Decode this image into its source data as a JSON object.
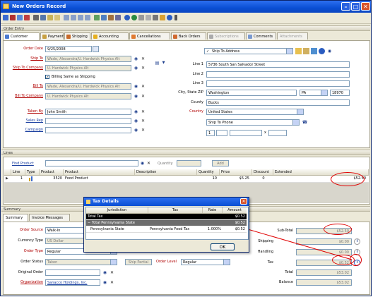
{
  "window": {
    "title": "New Orders Record"
  },
  "sections": {
    "order_entry": "Order Entry",
    "lines": "Lines",
    "summary": "Summary"
  },
  "tabs": [
    {
      "label": "Customer",
      "active": true
    },
    {
      "label": "Payment"
    },
    {
      "label": "Shipping"
    },
    {
      "label": "Accounting"
    },
    {
      "label": "Cancellations"
    },
    {
      "label": "Back Orders"
    },
    {
      "label": "Subscriptions",
      "disabled": true
    },
    {
      "label": "Comments"
    },
    {
      "label": "Attachments",
      "disabled": true
    }
  ],
  "customer": {
    "order_date_label": "Order Date",
    "order_date": "9/25/2008",
    "ship_to_label": "Ship To",
    "ship_to": "Wade, Alexandra/U. Hardwick Physics Alt",
    "ship_to_company_label": "Ship To Company",
    "ship_to_company": "U. Hardwick Physics Alt",
    "billing_same_label": "Billing Same as Shipping",
    "bill_to_label": "Bill To",
    "bill_to": "Wade, Alexandra/U. Hardwick Physics Alt",
    "bill_to_company_label": "Bill To Company",
    "bill_to_company": "U. Hardwick Physics Alt",
    "taken_by_label": "Taken By",
    "taken_by": "John Smith",
    "sales_rep_label": "Sales Rep",
    "sales_rep": "",
    "campaign_label": "Campaign",
    "campaign": ""
  },
  "address": {
    "type": "Ship To Address",
    "line1_label": "Line 1",
    "line1": "5736 South San Salvador Street",
    "line2_label": "Line 2",
    "line2": "",
    "line3_label": "Line 3",
    "line3": "",
    "city_label": "City, State ZIP",
    "city": "Washington",
    "state": "PA",
    "zip": "18970",
    "county_label": "County",
    "county": "Bucks",
    "country_label": "Country",
    "country": "United States",
    "phone_type": "Ship To Phone",
    "phone1": "1",
    "phone_ext_sep": "x"
  },
  "lines": {
    "find_product_label": "Find Product",
    "quantity_label": "Quantity",
    "add_label": "Add",
    "columns": [
      "Line",
      "Type",
      "Product",
      "Product",
      "Description",
      "Quantity",
      "Price",
      "Discount",
      "Extended"
    ],
    "rows": [
      {
        "line": "1",
        "product_code": "3520",
        "product": "Food Product",
        "description": "",
        "quantity": "10",
        "price": "$5.25",
        "discount": "0",
        "extended": "$52.50"
      }
    ]
  },
  "summary": {
    "tabs": [
      {
        "label": "Summary",
        "active": true
      },
      {
        "label": "Invoice Messages"
      }
    ],
    "order_source_label": "Order Source",
    "order_source": "Walk-In",
    "currency_label": "Currency Type",
    "currency": "US Dollar",
    "order_type_label": "Order Type",
    "order_type": "Regular",
    "order_status_label": "Order Status",
    "order_status": "Taken",
    "ship_partial_label": "Ship Partial",
    "order_level_label": "Order Level",
    "order_level": "Regular",
    "original_order_label": "Original Order",
    "original_order": "",
    "organization_label": "Organization",
    "organization": "Sanacco Holdings, Inc.",
    "subtotal_label": "Sub-Total",
    "subtotal": "$52.50",
    "shipping_label": "Shipping",
    "shipping": "$0.00",
    "handling_label": "Handling",
    "handling": "$0.00",
    "tax_label": "Tax",
    "tax": "$0.52",
    "total_label": "Total",
    "total": "$53.02",
    "balance_label": "Balance",
    "balance": "$53.02"
  },
  "tax_dialog": {
    "title": "Tax Details",
    "columns": [
      "Jurisdiction",
      "Tax",
      "Rate",
      "Amount"
    ],
    "total_row": {
      "label": "Total Tax",
      "amount": "$0.52"
    },
    "group_row": {
      "label": "Total Pennsylvania State",
      "amount": "$0.52"
    },
    "rows": [
      {
        "jurisdiction": "Pennsylvania State",
        "tax": "Pennsylvania Food Tax",
        "rate": "1.000%",
        "amount": "$0.52"
      }
    ],
    "ok_label": "OK"
  },
  "colors": {
    "titlebar": "#0a4fd4",
    "annotation": "#e00000",
    "required_label": "#b00000"
  }
}
